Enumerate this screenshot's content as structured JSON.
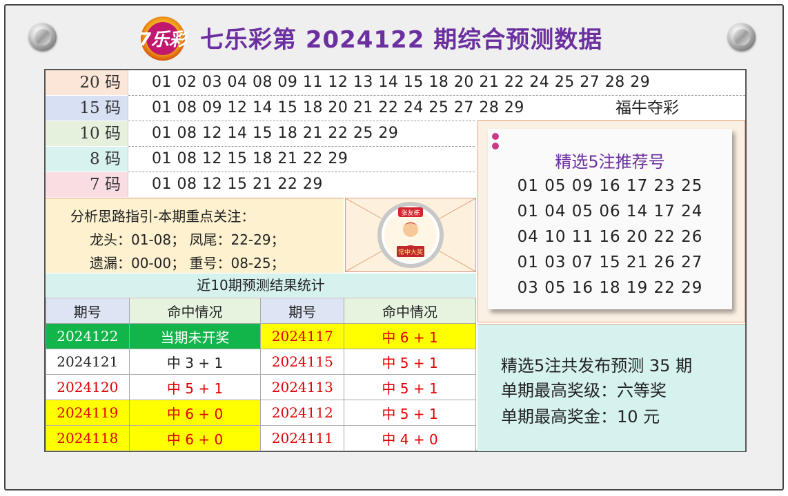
{
  "header": {
    "logo_text": "7乐彩",
    "title": "七乐彩第 2024122 期综合预测数据"
  },
  "code_rows": [
    {
      "label": "20 码",
      "bg": "#fbe6d8",
      "numbers": "01 02 03 04 08 09 11 12 13 14 15 18 20 21 22 24 25 27 28 29"
    },
    {
      "label": "15 码",
      "bg": "#d8e0f3",
      "numbers": "01 08 09 12 14 15 18 20 21 22 24 25 27 28 29"
    },
    {
      "label": "10 码",
      "bg": "#e5f1dd",
      "numbers": "01 08 12 14 15 18 21 22 25 29"
    },
    {
      "label": "8 码",
      "bg": "#d8f2ef",
      "numbers": "01 08 12 15 18 21 22 29"
    },
    {
      "label": "7 码",
      "bg": "#f9dde3",
      "numbers": "01 08 12 15 21 22 29"
    }
  ],
  "brand_text": "福牛夺彩",
  "analysis": {
    "heading": "分析思路指引-本期重点关注：",
    "line1": "龙头：01-08； 凤尾：22-29；",
    "line2": "遗漏：00-00； 重号：08-25；"
  },
  "badge": {
    "top_text": "张友栋",
    "bottom_text": "常中大奖"
  },
  "picks": {
    "title": "精选5注推荐号",
    "lines": [
      "01 05 09 16 17 23 25",
      "01 04 05 06 14 17 24",
      "04 10 11 16 20 22 26",
      "01 03 07 15 21 26 27",
      "03 05 16 18 19 22 29"
    ]
  },
  "stats": {
    "line1": "精选5注共发布预测 35 期",
    "line2": "单期最高奖级：六等奖",
    "line3": "单期最高奖金：10 元"
  },
  "results": {
    "title": "近10期预测结果统计",
    "headers": [
      "期号",
      "命中情况",
      "期号",
      "命中情况"
    ],
    "rows": [
      {
        "p1": "2024122",
        "r1": "当期未开奖",
        "p2": "2024117",
        "r2": "中 6 + 1"
      },
      {
        "p1": "2024121",
        "r1": "中 3 + 1",
        "p2": "2024115",
        "r2": "中 5 + 1"
      },
      {
        "p1": "2024120",
        "r1": "中 5 + 1",
        "p2": "2024113",
        "r2": "中 5 + 1"
      },
      {
        "p1": "2024119",
        "r1": "中 6 + 0",
        "p2": "2024112",
        "r2": "中 5 + 1"
      },
      {
        "p1": "2024118",
        "r1": "中 6 + 0",
        "p2": "2024111",
        "r2": "中 4 + 0"
      }
    ]
  }
}
